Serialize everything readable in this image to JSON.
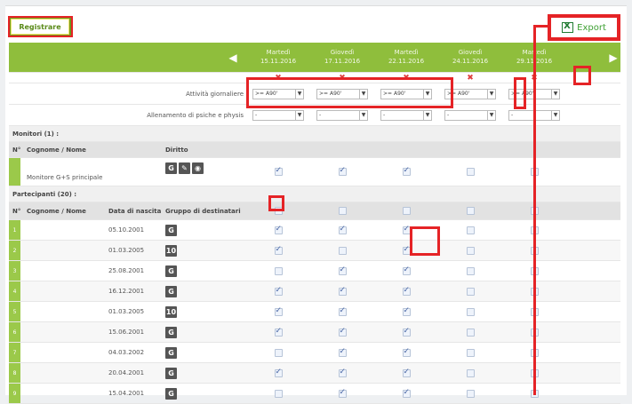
{
  "toolbar": {
    "register_label": "Registrare",
    "export_label": "Export"
  },
  "dates": [
    {
      "day": "Martedì",
      "date": "15.11.2016"
    },
    {
      "day": "Giovedì",
      "date": "17.11.2016"
    },
    {
      "day": "Martedì",
      "date": "22.11.2016"
    },
    {
      "day": "Giovedì",
      "date": "24.11.2016"
    },
    {
      "day": "Martedì",
      "date": "29.11.2016"
    }
  ],
  "attivita": {
    "label": "Attività giornaliere",
    "values": [
      ">= A90'",
      ">= A90'",
      ">= A90'",
      ">= A90'",
      ">= A90'"
    ]
  },
  "allenamento": {
    "label": "Allenamento di psiche e physis",
    "values": [
      "-",
      "-",
      "-",
      "-",
      "-"
    ]
  },
  "monitori": {
    "section_label": "Monitori (1) :",
    "headers": {
      "no": "N°",
      "name": "Cognome / Nome",
      "right": "Diritto"
    },
    "rows": [
      {
        "name": "Monitore G+S principale",
        "checks": [
          true,
          true,
          true,
          false,
          false
        ]
      }
    ]
  },
  "partecipanti": {
    "section_label": "Partecipanti (20) :",
    "headers": {
      "no": "N°",
      "name": "Cognome / Nome",
      "birth": "Data di nascita",
      "group": "Gruppo di destinatari"
    },
    "rows": [
      {
        "no": "1",
        "birth": "05.10.2001",
        "group": "G",
        "checks": [
          true,
          true,
          true,
          false,
          false
        ]
      },
      {
        "no": "2",
        "birth": "01.03.2005",
        "group": "10",
        "checks": [
          true,
          false,
          true,
          false,
          false
        ]
      },
      {
        "no": "3",
        "birth": "25.08.2001",
        "group": "G",
        "checks": [
          false,
          true,
          true,
          false,
          false
        ]
      },
      {
        "no": "4",
        "birth": "16.12.2001",
        "group": "G",
        "checks": [
          true,
          true,
          true,
          false,
          false
        ]
      },
      {
        "no": "5",
        "birth": "01.03.2005",
        "group": "10",
        "checks": [
          true,
          true,
          true,
          false,
          false
        ]
      },
      {
        "no": "6",
        "birth": "15.06.2001",
        "group": "G",
        "checks": [
          true,
          true,
          true,
          false,
          false
        ]
      },
      {
        "no": "7",
        "birth": "04.03.2002",
        "group": "G",
        "checks": [
          false,
          true,
          true,
          false,
          false
        ]
      },
      {
        "no": "8",
        "birth": "20.04.2001",
        "group": "G",
        "checks": [
          true,
          true,
          true,
          false,
          false
        ]
      },
      {
        "no": "9",
        "birth": "15.04.2001",
        "group": "G",
        "checks": [
          false,
          true,
          true,
          false,
          false
        ]
      }
    ]
  },
  "colors": {
    "accent_green": "#9bc94a",
    "highlight_red": "#e52326"
  },
  "icons": [
    "excel-icon",
    "arrow-left-icon",
    "arrow-right-icon",
    "delete-x-icon",
    "rights-g-icon",
    "rights-edit-icon",
    "rights-view-icon"
  ]
}
